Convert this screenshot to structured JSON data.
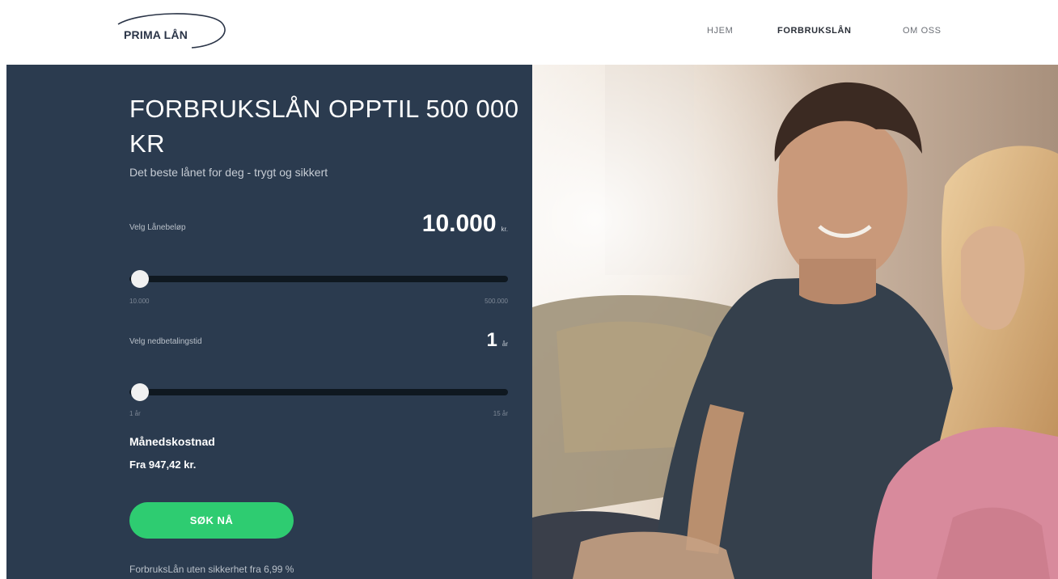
{
  "header": {
    "logo_text": "PRIMA LÅN",
    "nav": [
      {
        "label": "HJEM",
        "active": false
      },
      {
        "label": "FORBRUKSLÅN",
        "active": true
      },
      {
        "label": "OM OSS",
        "active": false
      }
    ]
  },
  "hero": {
    "title": "FORBRUKSLÅN OPPTIL 500 000 KR",
    "subtitle": "Det beste lånet for deg - trygt og sikkert",
    "loan_amount": {
      "label": "Velg Lånebeløp",
      "value": "10.000",
      "unit": "kr.",
      "min_label": "10.000",
      "max_label": "500.000",
      "position": 0
    },
    "repayment": {
      "label": "Velg nedbetalingstid",
      "value": "1",
      "unit": "år",
      "min_label": "1 år",
      "max_label": "15 år",
      "position": 0
    },
    "monthly_cost_label": "Månedskostnad",
    "monthly_cost_value": "Fra 947,42 kr.",
    "cta_label": "SØK NÅ",
    "footnote": "ForbruksLån uten sikkerhet fra 6,99 %"
  },
  "image": {
    "description_icon": "couple-photo"
  },
  "colors": {
    "panel": "#2b3b4f",
    "cta": "#2ecc71",
    "track": "#0f1820",
    "knob": "#f1f1f1"
  }
}
